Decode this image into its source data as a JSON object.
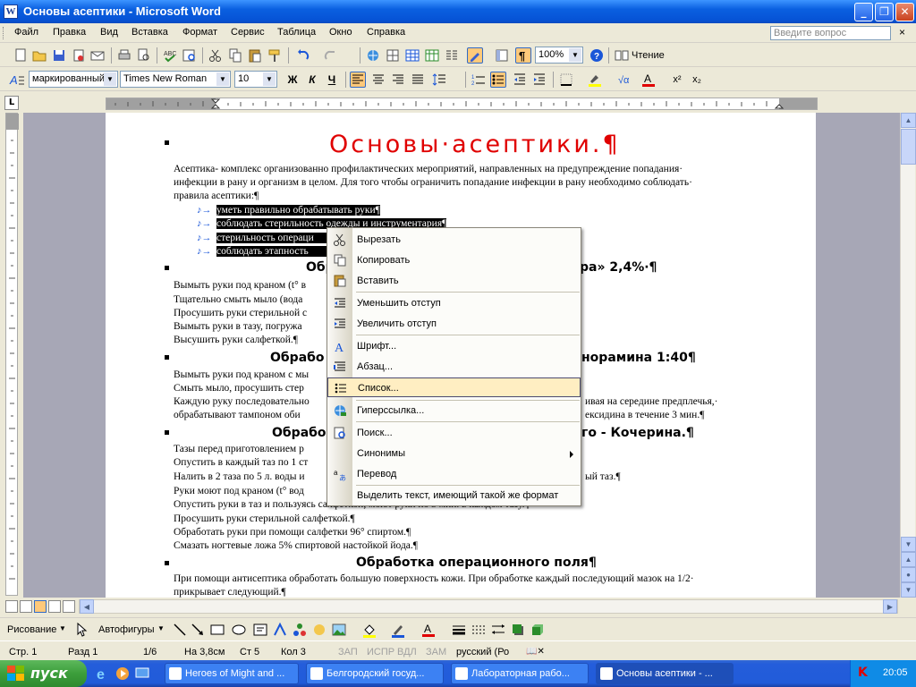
{
  "window": {
    "title": "Основы асептики - Microsoft Word"
  },
  "menu": {
    "items": [
      "Файл",
      "Правка",
      "Вид",
      "Вставка",
      "Формат",
      "Сервис",
      "Таблица",
      "Окно",
      "Справка"
    ],
    "ask_placeholder": "Введите вопрос",
    "close": "×"
  },
  "standard_toolbar": {
    "zoom": "100%",
    "reading_label": "Чтение"
  },
  "formatting_toolbar": {
    "style": "маркированный",
    "font": "Times New Roman",
    "size": "10",
    "bold": "Ж",
    "italic": "К",
    "underline": "Ч"
  },
  "document": {
    "title": "Основы·асептики.¶",
    "intro": [
      "Асептика- комплекс организованно профилактических мероприятий, направленных на предупреждение попадания·",
      "инфекции в рану и организм в целом. Для того чтобы ограничить попадание инфекции в рану необходимо соблюдать·",
      "правила асептики:¶"
    ],
    "selected_items": [
      "уметь правильно обрабатывать руки¶",
      "соблюдать стерильность одежды и инструментария¶",
      "стерильность операци",
      "соблюдать этапность"
    ],
    "section1": {
      "heading_left": "Обр",
      "heading_right": "ра» 2,4%·¶",
      "lines": [
        "Вымыть руки под краном (t° в",
        "Тщательно смыть мыло (вода",
        "Просушить руки стерильной с",
        "Вымыть руки в тазу, погружа",
        "Высушить руки салфеткой.¶"
      ]
    },
    "section2": {
      "heading_left": "Обрабо",
      "heading_right": "норамина 1:40¶",
      "lines": [
        "Вымыть руки под краном с мы",
        "Смыть мыло, просушить стер",
        "Каждую руку последовательно",
        "обрабатывают тампоном оби"
      ],
      "line3_right": "ивая на середине предплечья,·",
      "line4_right": "ексидина в течение 3 мин.¶"
    },
    "section3": {
      "heading_left": "Обрабо",
      "heading_right": "го - Кочерина.¶",
      "lines": [
        "Тазы перед приготовлением р",
        "Опустить в каждый таз по 1 ст",
        "Налить в 2 таза по 5 л. воды и",
        "Руки моют под краном (t° вод",
        "Опустить руки в таз и пользуясь салфеткой, моют руки по 3 мин. в каждом тазу.¶",
        "Просушить руки стерильной салфеткой.¶",
        "Обработать руки при помощи салфетки 96° спиртом.¶",
        "Смазать ногтевые ложа 5% спиртовой настойкой йода.¶"
      ],
      "line3_right": "ый таз.¶"
    },
    "section4": {
      "heading": "Обработка операционного поля¶",
      "lines": [
        "При помощи антисептика обработать большую поверхность кожи. При обработке каждый последующий мазок на 1/2·",
        "прикрывает следующий.¶"
      ]
    }
  },
  "context_menu": {
    "items": [
      {
        "label": "Вырезать",
        "icon": "scissors-icon"
      },
      {
        "label": "Копировать",
        "icon": "copy-icon"
      },
      {
        "label": "Вставить",
        "icon": "paste-icon"
      },
      {
        "label": "Уменьшить отступ",
        "icon": "decrease-indent-icon"
      },
      {
        "label": "Увеличить отступ",
        "icon": "increase-indent-icon"
      },
      {
        "label": "Шрифт...",
        "icon": "font-icon"
      },
      {
        "label": "Абзац...",
        "icon": "paragraph-icon"
      },
      {
        "label": "Список...",
        "icon": "list-icon"
      },
      {
        "label": "Гиперссылка...",
        "icon": "hyperlink-icon"
      },
      {
        "label": "Поиск...",
        "icon": "search-icon"
      },
      {
        "label": "Синонимы",
        "icon": ""
      },
      {
        "label": "Перевод",
        "icon": "translate-icon"
      },
      {
        "label": "Выделить текст, имеющий такой же формат",
        "icon": ""
      }
    ],
    "highlighted": "Список..."
  },
  "drawing_toolbar": {
    "draw_label": "Рисование",
    "autoshapes_label": "Автофигуры"
  },
  "status": {
    "page": "Стр. 1",
    "section": "Разд 1",
    "pages": "1/6",
    "at": "На 3,8см",
    "line": "Ст 5",
    "col": "Кол 3",
    "rec": "ЗАП",
    "trk": "ИСПР",
    "ext": "ВДЛ",
    "ovr": "ЗАМ",
    "lang": "русский (Ро"
  },
  "taskbar": {
    "start": "пуск",
    "tasks": [
      "Heroes of Might and ...",
      "Белгородский госуд...",
      "Лабораторная рабо...",
      "Основы асептики - ..."
    ],
    "clock": "20:05"
  },
  "colors": {
    "title_red": "#e00000",
    "xp_blue": "#0653d6",
    "highlight": "#ffeec2"
  }
}
